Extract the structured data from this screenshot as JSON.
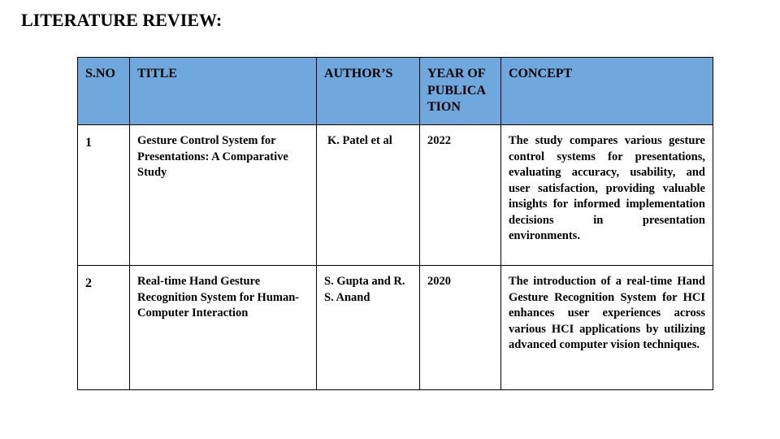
{
  "slide": {
    "title": "LITERATURE REVIEW:"
  },
  "table": {
    "header_color": "#6fa8dc",
    "columns": [
      "S.NO",
      "TITLE",
      "AUTHOR’S",
      "YEAR OF PUBLICATION",
      "CONCEPT"
    ],
    "rows": [
      {
        "sno": "1",
        "title": "Gesture Control System for Presentations: A Comparative Study",
        "authors": "K. Patel et al",
        "year": "2022",
        "concept": "The study compares various gesture control systems for presentations, evaluating accuracy, usability, and user satisfaction, providing valuable insights for informed implementation decisions in presentation environments."
      },
      {
        "sno": "2",
        "title": "Real-time Hand Gesture Recognition System for Human-Computer Interaction",
        "authors": "S. Gupta and R. S. Anand",
        "year": "2020",
        "concept": "The introduction of a real-time Hand Gesture Recognition System for HCI enhances user experiences across various HCI applications by utilizing advanced computer vision techniques."
      }
    ]
  }
}
